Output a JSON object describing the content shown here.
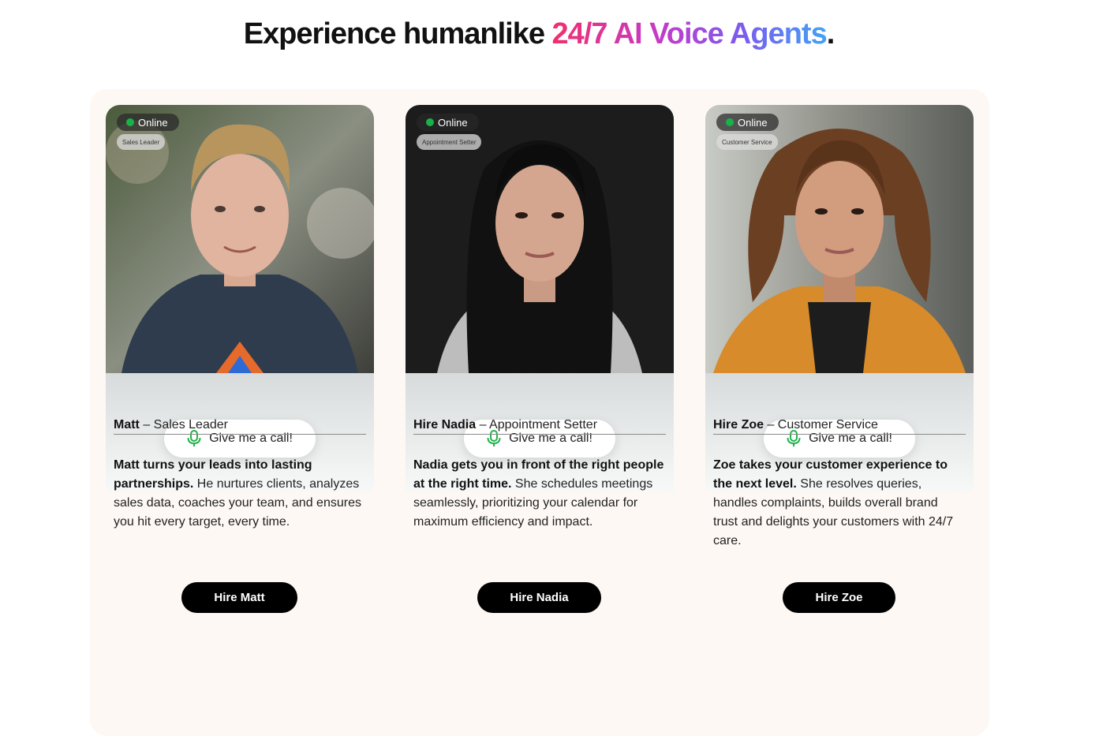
{
  "headline": {
    "prefix": "Experience humanlike ",
    "highlight": "24/7 AI Voice Agents",
    "suffix": "."
  },
  "cards": [
    {
      "status": "Online",
      "role_badge": "Sales Leader",
      "call_label": "Give me a call!",
      "name": "Matt",
      "role": " – Sales Leader",
      "desc_bold": "Matt turns your leads into lasting partnerships.",
      "desc_rest": " He nurtures clients, analyzes sales data, coaches your team, and ensures you hit every target, every time.",
      "hire_label": "Hire Matt"
    },
    {
      "status": "Online",
      "role_badge": "Appointment Setter",
      "call_label": "Give me a call!",
      "name": "Hire Nadia",
      "role": " – Appointment Setter",
      "desc_bold": "Nadia gets you in front of the right people at the right time.",
      "desc_rest": " She schedules meetings seamlessly, prioritizing your calendar for maximum efficiency and impact.",
      "hire_label": "Hire Nadia"
    },
    {
      "status": "Online",
      "role_badge": "Customer Service",
      "call_label": "Give me a call!",
      "name": "Hire Zoe",
      "role": " – Customer Service",
      "desc_bold": "Zoe takes your customer experience to the next level.",
      "desc_rest": " She resolves queries, handles complaints, builds overall brand trust and delights your customers with 24/7 care.",
      "hire_label": "Hire Zoe"
    }
  ],
  "colors": {
    "accent_gradient": [
      "#f0306e",
      "#c23cc9",
      "#7a5cf0",
      "#41a3f5"
    ],
    "online": "#16b34a",
    "mic": "#22b34c",
    "panel_bg": "#fdf8f3"
  },
  "icons": {
    "mic": "microphone-icon",
    "status": "online-dot-icon"
  }
}
